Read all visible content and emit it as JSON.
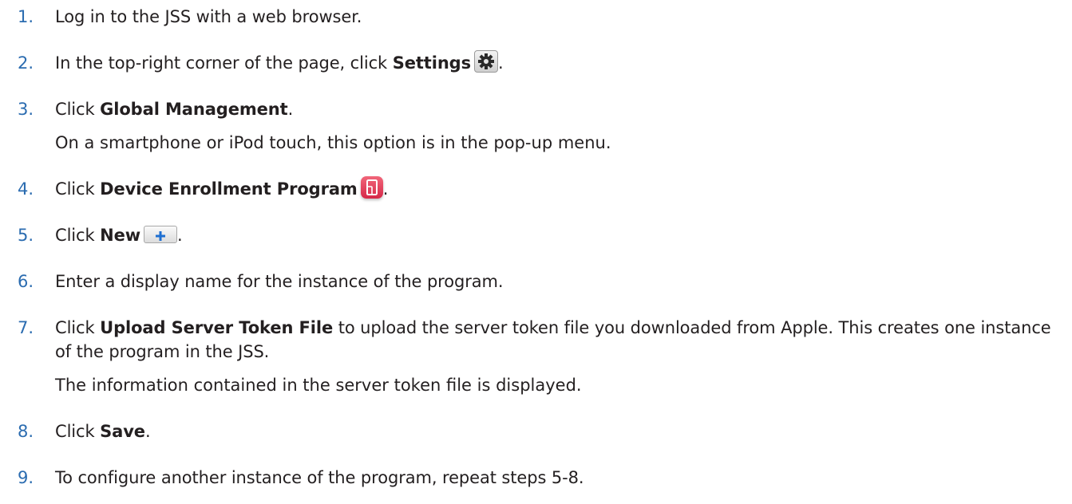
{
  "steps": [
    {
      "number": "1.",
      "text": "Log in to the JSS with a web browser."
    },
    {
      "number": "2.",
      "pre": "In the top-right corner of the page, click ",
      "bold": "Settings",
      "icon": "gear-icon",
      "post": "."
    },
    {
      "number": "3.",
      "pre": "Click ",
      "bold": "Global Management",
      "post": ".",
      "sub": "On a smartphone or iPod touch, this option is in the pop-up menu."
    },
    {
      "number": "4.",
      "pre": "Click ",
      "bold": "Device Enrollment Program",
      "icon": "device-enrollment-icon",
      "post": "."
    },
    {
      "number": "5.",
      "pre": "Click ",
      "bold": "New",
      "icon": "plus-icon",
      "post": "."
    },
    {
      "number": "6.",
      "text": "Enter a display name for the instance of the program."
    },
    {
      "number": "7.",
      "pre": "Click ",
      "bold": "Upload Server Token File",
      "post": " to upload the server token file you downloaded from Apple. This creates one instance of the program in the JSS.",
      "sub": "The information contained in the server token file is displayed."
    },
    {
      "number": "8.",
      "pre": "Click ",
      "bold": "Save",
      "post": "."
    },
    {
      "number": "9.",
      "text": "To configure another instance of the program, repeat steps 5-8."
    }
  ],
  "colors": {
    "number": "#2b6cb0",
    "text": "#231f20",
    "dep_icon": "#e03a55",
    "plus_icon": "#1f6fd1"
  }
}
